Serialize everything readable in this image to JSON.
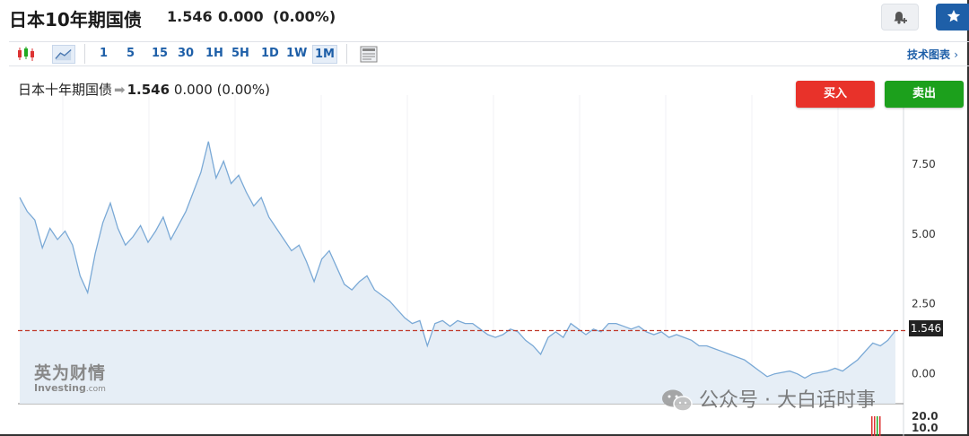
{
  "header": {
    "title": "日本10年期国债",
    "price": "1.546",
    "change": "0.000",
    "change_pct": "(0.00%)"
  },
  "toolbar": {
    "timeframes": [
      "1",
      "5",
      "15",
      "30",
      "1H",
      "5H",
      "1D",
      "1W",
      "1M"
    ],
    "active_timeframe": "1M",
    "tech_chart_link": "技术图表"
  },
  "legend": {
    "name": "日本十年期国债",
    "price": "1.546",
    "change": "0.000",
    "change_pct": "(0.00%)"
  },
  "actions": {
    "buy": "买入",
    "sell": "卖出"
  },
  "watermark": {
    "cn": "英为财情",
    "en": "Investing",
    "en_suffix": ".com"
  },
  "overlay_text": "公众号 · 大白话时事",
  "colors": {
    "accent": "#1e5fa8",
    "buy": "#e8322a",
    "sell": "#1ca01c",
    "line": "#7aa9d6",
    "fill": "#e3ecf5",
    "ref_line": "#c0392b"
  },
  "chart_data": {
    "type": "area",
    "series_name": "",
    "current_value": 1.546,
    "price_label": "1.546",
    "y_ticks": [
      "7.50",
      "5.00",
      "2.50",
      "0.00"
    ],
    "volume_tick": "20.0",
    "volume_tick2": "10.0",
    "ylim": [
      -1.1,
      9.0
    ],
    "values": [
      6.3,
      5.8,
      5.5,
      4.5,
      5.2,
      4.8,
      5.1,
      4.6,
      3.5,
      2.9,
      4.3,
      5.4,
      6.1,
      5.2,
      4.6,
      4.9,
      5.3,
      4.7,
      5.1,
      5.6,
      4.8,
      5.3,
      5.8,
      6.5,
      7.2,
      8.3,
      7.0,
      7.6,
      6.8,
      7.1,
      6.5,
      6.0,
      6.3,
      5.6,
      5.2,
      4.8,
      4.4,
      4.6,
      4.0,
      3.3,
      4.1,
      4.4,
      3.8,
      3.2,
      3.0,
      3.3,
      3.5,
      3.0,
      2.8,
      2.6,
      2.3,
      2.0,
      1.8,
      1.9,
      1.0,
      1.8,
      1.9,
      1.7,
      1.9,
      1.8,
      1.8,
      1.6,
      1.4,
      1.3,
      1.4,
      1.6,
      1.5,
      1.2,
      1.0,
      0.7,
      1.3,
      1.5,
      1.3,
      1.8,
      1.6,
      1.4,
      1.6,
      1.5,
      1.8,
      1.8,
      1.7,
      1.6,
      1.7,
      1.5,
      1.4,
      1.5,
      1.3,
      1.4,
      1.3,
      1.2,
      1.0,
      1.0,
      0.9,
      0.8,
      0.7,
      0.6,
      0.5,
      0.3,
      0.1,
      -0.1,
      0.0,
      0.05,
      0.1,
      0.0,
      -0.15,
      0.0,
      0.05,
      0.1,
      0.2,
      0.1,
      0.3,
      0.5,
      0.8,
      1.1,
      1.0,
      1.2,
      1.546
    ]
  }
}
